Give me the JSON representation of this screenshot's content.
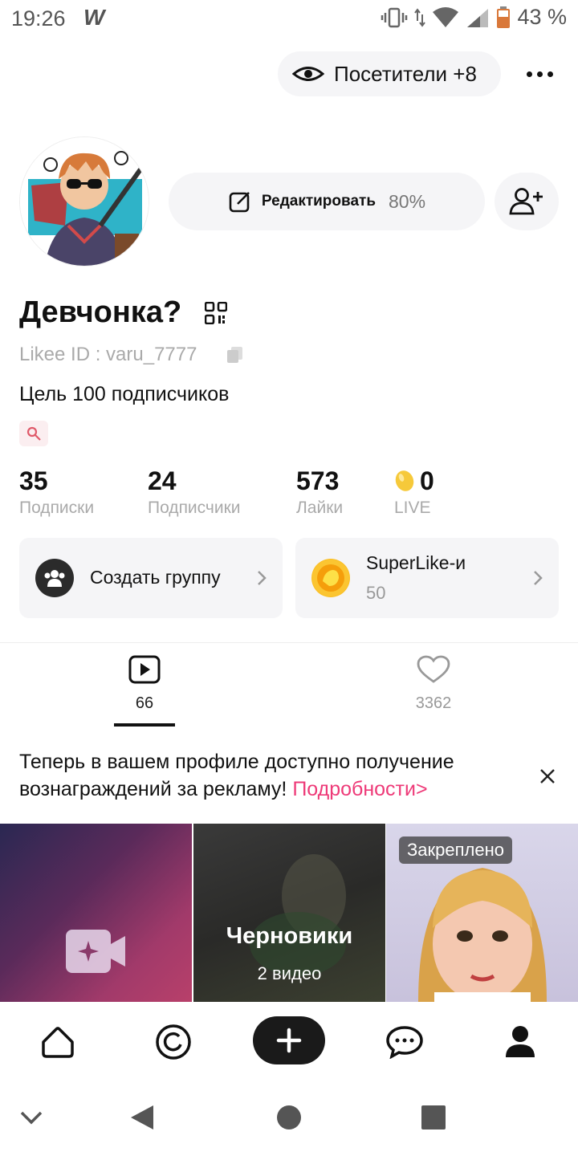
{
  "status_bar": {
    "time": "19:26",
    "app_glyph": "W",
    "battery_percent": "43 %",
    "icons": [
      "vibrate-icon",
      "data-arrows-icon",
      "wifi-icon",
      "signal-icon",
      "battery-icon"
    ]
  },
  "header": {
    "visitors_label": "Посетители +8",
    "more_icon": "more-dots-icon"
  },
  "profile": {
    "edit_label": "Редактировать",
    "edit_progress": "80%",
    "name": "Девчонка?",
    "likee_id": "Likee ID : varu_7777",
    "bio": "Цель 100 подписчиков"
  },
  "stats": [
    {
      "value": "35",
      "label": "Подписки"
    },
    {
      "value": "24",
      "label": "Подписчики"
    },
    {
      "value": "573",
      "label": "Лайки"
    },
    {
      "value": "0",
      "label": "LIVE"
    }
  ],
  "cards": {
    "group": {
      "title": "Создать группу"
    },
    "superlike": {
      "title": "SuperLike-и",
      "count": "50"
    }
  },
  "tabs": {
    "videos_count": "66",
    "likes_count": "3362"
  },
  "promo": {
    "text": "Теперь в вашем профиле доступно получение вознаграждений за рекламу! ",
    "link": "Подробности>"
  },
  "grid": {
    "drafts_title": "Черновики",
    "drafts_sub": "2 видео",
    "pinned_badge": "Закреплено"
  },
  "colors": {
    "accent": "#ee3a78",
    "surface": "#f5f5f7",
    "text_muted": "#aaaaaa"
  }
}
